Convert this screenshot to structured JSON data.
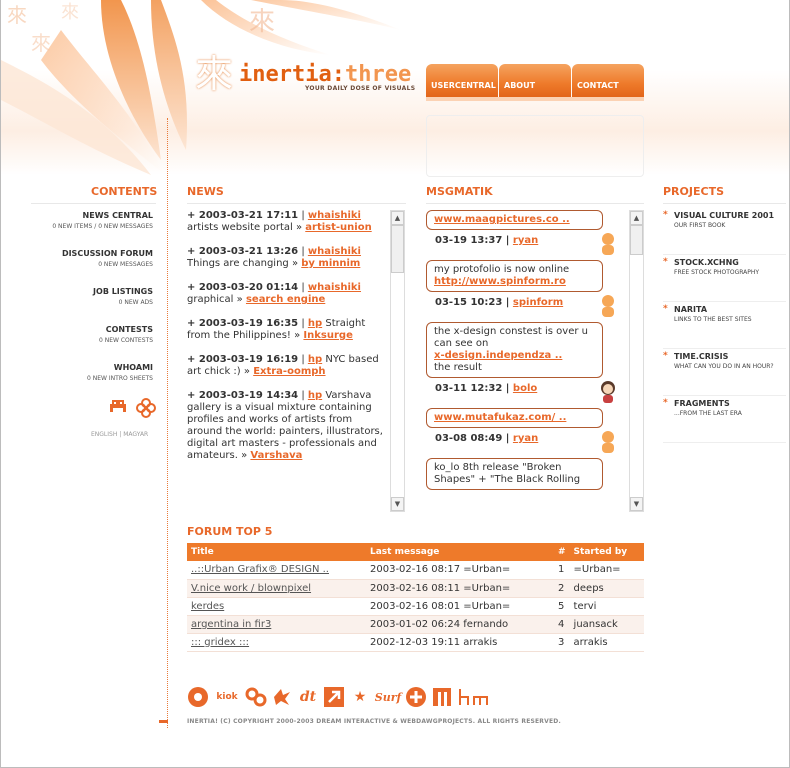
{
  "site": {
    "logo_glyph": "來",
    "logo_part1": "inertia:",
    "logo_part2": "three",
    "tagline": "YOUR DAILY DOSE OF VISUALS"
  },
  "nav": {
    "tabs": [
      "USERCENTRAL",
      "ABOUT",
      "CONTACT"
    ]
  },
  "contents": {
    "title": "CONTENTS",
    "items": [
      {
        "label": "NEWS CENTRAL",
        "sub": "0 NEW ITEMS / 0 NEW MESSAGES"
      },
      {
        "label": "DISCUSSION FORUM",
        "sub": "0 NEW MESSAGES"
      },
      {
        "label": "JOB LISTINGS",
        "sub": "0 NEW ADS"
      },
      {
        "label": "CONTESTS",
        "sub": "0 NEW CONTESTS"
      },
      {
        "label": "WHOAMI",
        "sub": "0 NEW INTRO SHEETS"
      }
    ],
    "lang_en": "ENGLISH",
    "lang_sep": " | ",
    "lang_hu": "MAGYAR"
  },
  "news": {
    "title": "NEWS",
    "items": [
      {
        "date": "+ 2003-03-21 17:11",
        "user": "whaishiki",
        "text": "artists website portal »",
        "link": "artist-union"
      },
      {
        "date": "+ 2003-03-21 13:26",
        "user": "whaishiki",
        "text": "Things are changing »",
        "link": "by minnim"
      },
      {
        "date": "+ 2003-03-20 01:14",
        "user": "whaishiki",
        "text": "graphical »",
        "link": "search engine"
      },
      {
        "date": "+ 2003-03-19 16:35",
        "user": "hp",
        "text": "Straight from the Philippines! »",
        "link": "Inksurge"
      },
      {
        "date": "+ 2003-03-19 16:19",
        "user": "hp",
        "text": "NYC based art chick :) »",
        "link": "Extra-oomph"
      },
      {
        "date": "+ 2003-03-19 14:34",
        "user": "hp",
        "text": "Varshava gallery is a visual mixture containing profiles and works of artists from around the world: painters, illustrators, digital art masters - professionals and amateurs. »",
        "link": "Varshava"
      }
    ]
  },
  "msgmatik": {
    "title": "MSGMATIK",
    "messages": [
      {
        "pre": "",
        "link": "www.maagpictures.co ..",
        "post": "",
        "meta": "03-19 13:37",
        "user": "ryan",
        "avatar": "orange"
      },
      {
        "pre": "my protofolio is now online",
        "link": "http://www.spinform.ro",
        "post": "",
        "meta": "03-15 10:23",
        "user": "spinform",
        "avatar": "orange"
      },
      {
        "pre": "the x-design constest is over u can see on",
        "link": "x-design.independza ..",
        "post": "the result",
        "meta": "03-11 12:32",
        "user": "bolo",
        "avatar": "girl"
      },
      {
        "pre": "",
        "link": "www.mutafukaz.com/ ..",
        "post": "",
        "meta": "03-08 08:49",
        "user": "ryan",
        "avatar": "orange"
      },
      {
        "pre": "ko_lo 8th release \"Broken Shapes\" + \"The Black Rolling",
        "link": "",
        "post": "",
        "meta": "",
        "user": "",
        "avatar": ""
      }
    ]
  },
  "projects": {
    "title": "PROJECTS",
    "items": [
      {
        "label": "VISUAL CULTURE 2001",
        "sub": "OUR FIRST BOOK"
      },
      {
        "label": "STOCK.XCHNG",
        "sub": "FREE STOCK PHOTOGRAPHY"
      },
      {
        "label": "NARITA",
        "sub": "LINKS TO THE BEST SITES"
      },
      {
        "label": "TIME.CRISIS",
        "sub": "WHAT CAN YOU DO IN AN HOUR?"
      },
      {
        "label": "FRAGMENTS",
        "sub": "...FROM THE LAST ERA"
      }
    ]
  },
  "forum": {
    "title": "FORUM TOP 5",
    "headers": [
      "Title",
      "Last message",
      "#",
      "Started by"
    ],
    "rows": [
      [
        "..::Urban Grafix® DESIGN ..",
        "2003-02-16 08:17 =Urban=",
        "1",
        "=Urban="
      ],
      [
        "V.nice work / blownpixel",
        "2003-02-16 08:11 =Urban=",
        "2",
        "deeps"
      ],
      [
        "kerdes",
        "2003-02-16 08:01 =Urban=",
        "5",
        "tervi"
      ],
      [
        "argentina in fir3",
        "2003-01-02 06:24 fernando",
        "4",
        "juansack"
      ],
      [
        "::: gridex :::",
        "2002-12-03 19:11 arrakis",
        "3",
        "arrakis"
      ]
    ]
  },
  "footer": {
    "partners": [
      "kiok",
      "links",
      "dt",
      "arrow",
      "star",
      "Surf",
      "plus",
      "gate",
      "hm"
    ],
    "copyright": "INERTIA! (C) COPYRIGHT 2000-2003 DREAM INTERACTIVE & WEBDAWGPROJECTS. ALL RIGHTS RESERVED."
  },
  "colors": {
    "accent": "#e8682a",
    "accent_light": "#f5a35f"
  }
}
